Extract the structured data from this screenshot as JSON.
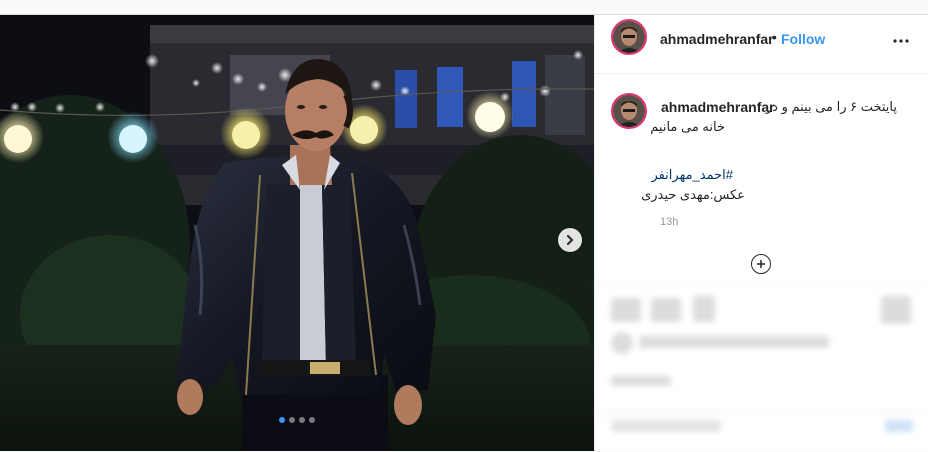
{
  "post": {
    "author": {
      "username": "ahmadmehranfar",
      "separator": "•",
      "follow_label": "Follow",
      "more_icon": "more-horizontal-icon"
    },
    "caption": {
      "username": "ahmadmehranfar",
      "line1": "پایتخت ۶ را می بینم و در",
      "line2": "خانه می مانیم",
      "hashtag": "#احمد_مهرانفر",
      "credit": "عکس:مهدی حیدری",
      "timestamp": "13h"
    },
    "carousel": {
      "slide_count": 4,
      "active_index": 0,
      "next_icon": "chevron-right-icon"
    },
    "load_more_icon": "plus-circle-icon"
  },
  "colors": {
    "accent": "#3897f0",
    "text": "#262626",
    "muted": "#999999",
    "hashtag": "#003569",
    "avatar_ring": "#e1306c"
  }
}
